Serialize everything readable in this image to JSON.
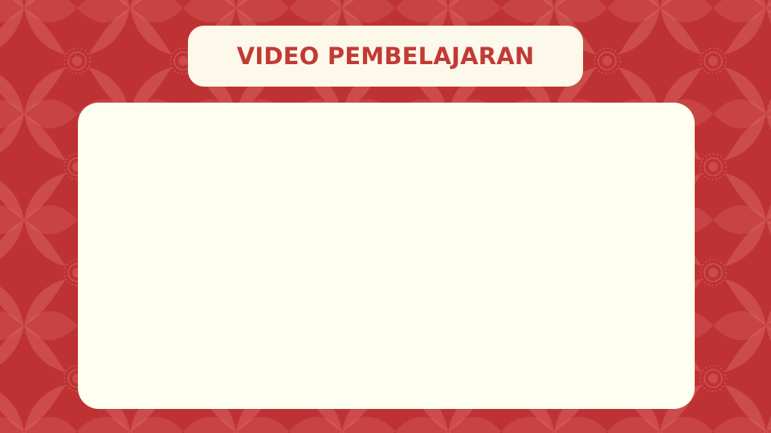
{
  "slide": {
    "title": "VIDEO PEMBELAJARAN"
  },
  "colors": {
    "background": "#bf3233",
    "pattern_light": "#e37a78",
    "title_pill": "#fcf8ea",
    "title_text": "#c23a36",
    "video_panel": "#fefff0"
  },
  "video_panel": {
    "content": ""
  }
}
